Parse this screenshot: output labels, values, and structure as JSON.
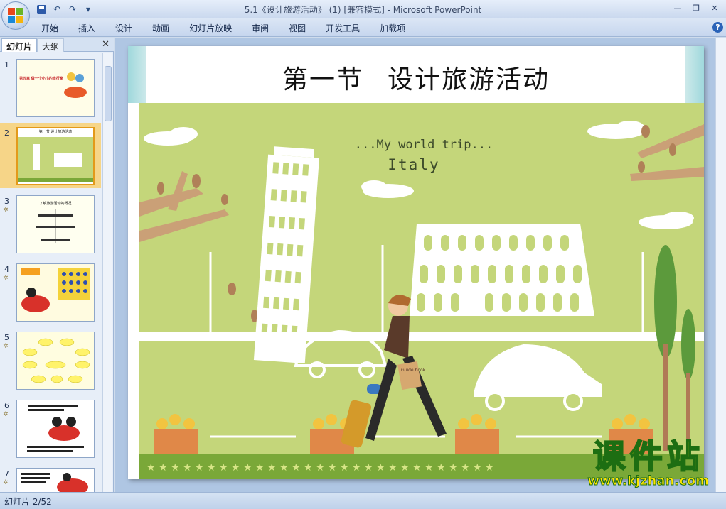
{
  "window": {
    "title": "5.1《设计旅游活动》 (1) [兼容模式] - Microsoft PowerPoint"
  },
  "ribbon": {
    "tabs": [
      "开始",
      "插入",
      "设计",
      "动画",
      "幻灯片放映",
      "审阅",
      "视图",
      "开发工具",
      "加载项"
    ]
  },
  "left_pane": {
    "tabs": [
      "幻灯片",
      "大纲"
    ],
    "thumbnails": [
      {
        "num": "1",
        "text": "第五章 做一个小小的旅行家"
      },
      {
        "num": "2",
        "text": "第一节 设计旅游活动"
      },
      {
        "num": "3",
        "text": "了解旅游活动的概况"
      },
      {
        "num": "4",
        "text": ""
      },
      {
        "num": "5",
        "text": ""
      },
      {
        "num": "6",
        "text": ""
      },
      {
        "num": "7",
        "text": ""
      }
    ]
  },
  "slide": {
    "title_part1": "第一节",
    "title_part2": "设计旅游活动",
    "subtitle_line1": "...My world trip...",
    "subtitle_line2": "Italy",
    "book_label": "Guide book"
  },
  "status": {
    "slide_counter": "幻灯片 2/52"
  },
  "watermark": {
    "cn": "课件站",
    "url": "www.kjzhan.com"
  },
  "colors": {
    "slide_bg_green": "#c4d67a",
    "ground_green": "#7aa838"
  }
}
